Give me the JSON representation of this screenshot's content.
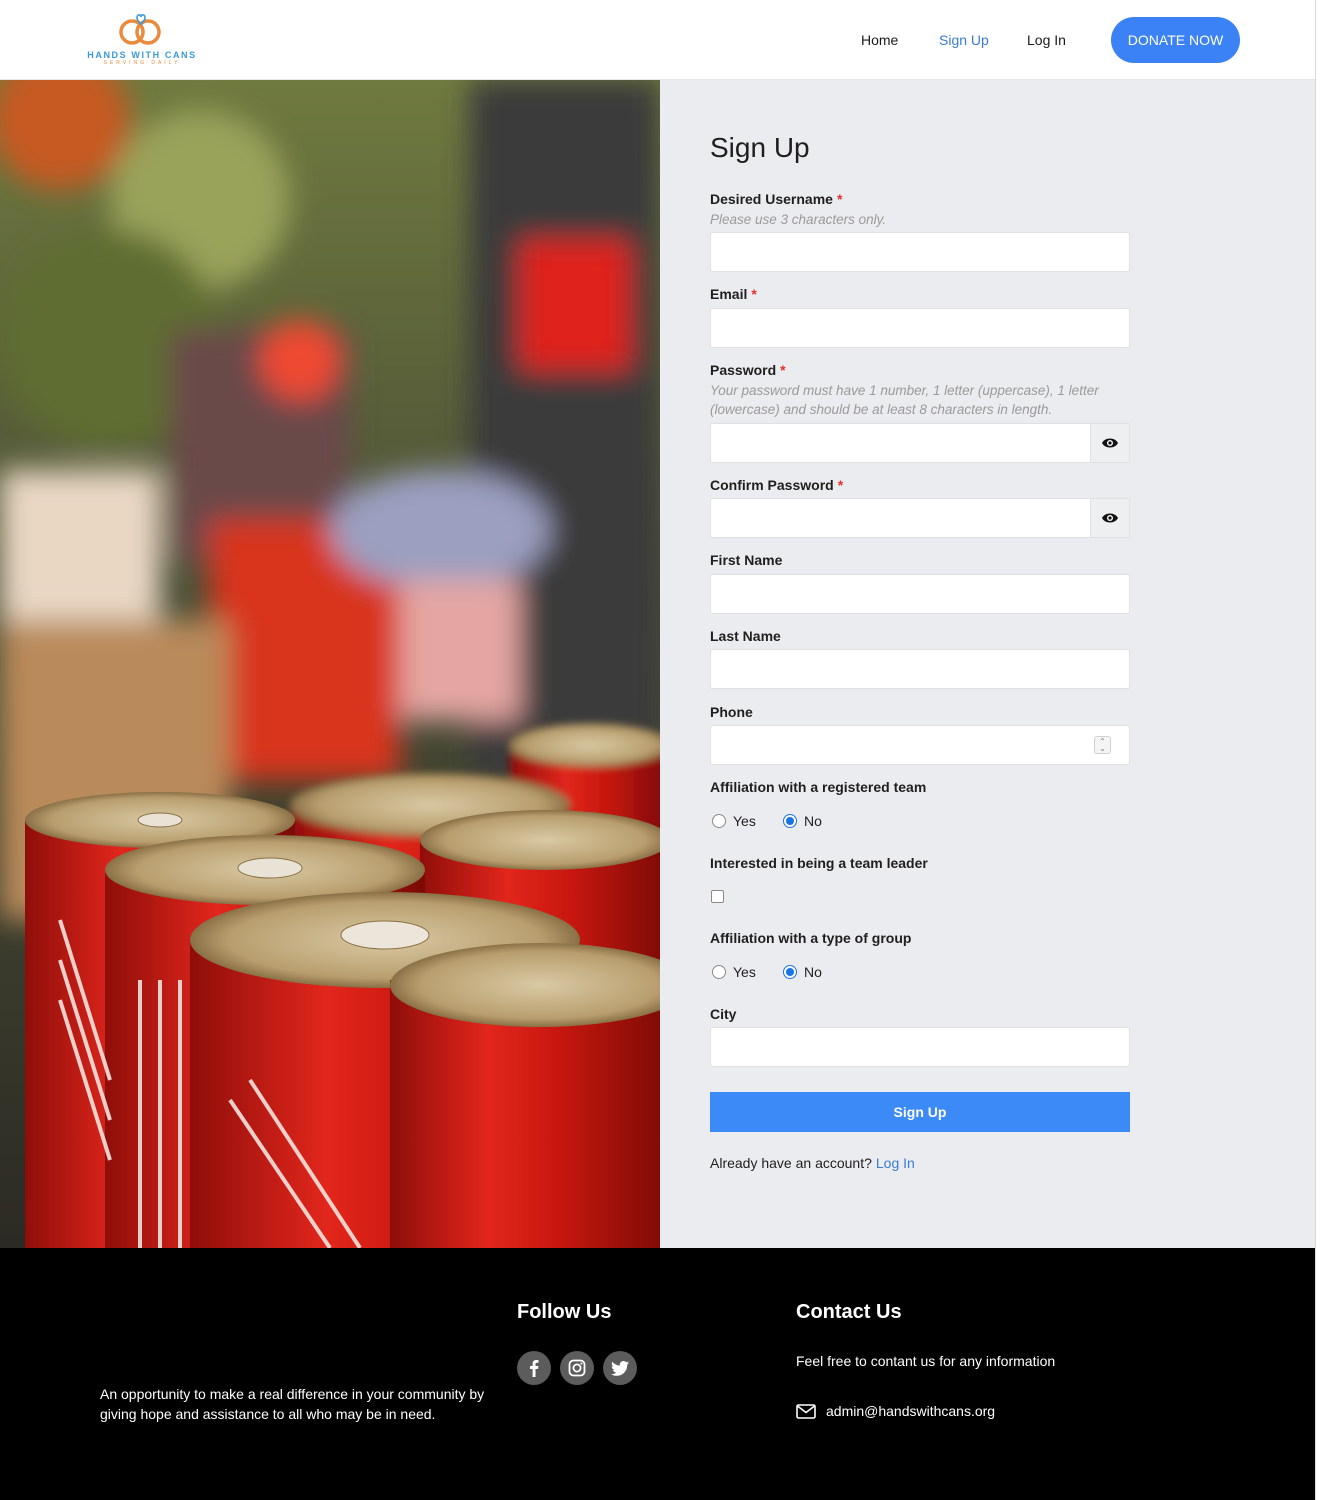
{
  "brand": {
    "name": "HANDS WITH CANS",
    "tagline": "SERVING DAILY"
  },
  "nav": {
    "home": "Home",
    "signup": "Sign Up",
    "login": "Log In",
    "donate": "DONATE NOW"
  },
  "colors": {
    "accent": "#3b82f6",
    "link": "#3a7bd5",
    "required": "#e03131",
    "panel_bg": "#ebecef",
    "footer_bg": "#000000"
  },
  "form": {
    "title": "Sign Up",
    "required_mark": "*",
    "username": {
      "label": "Desired Username",
      "hint": "Please use 3 characters only.",
      "value": "",
      "required": true
    },
    "email": {
      "label": "Email",
      "value": "",
      "required": true
    },
    "password": {
      "label": "Password",
      "hint": "Your password must have 1 number, 1 letter (uppercase), 1 letter (lowercase) and should be at least 8 characters in length.",
      "value": "",
      "required": true,
      "toggle_icon": "eye-icon"
    },
    "confirm_password": {
      "label": "Confirm Password",
      "value": "",
      "required": true,
      "toggle_icon": "eye-icon"
    },
    "first_name": {
      "label": "First Name",
      "value": ""
    },
    "last_name": {
      "label": "Last Name",
      "value": ""
    },
    "phone": {
      "label": "Phone",
      "value": "",
      "stepper_icon": "spinner-icon"
    },
    "affiliation_team": {
      "label": "Affiliation with a registered team",
      "options": [
        "Yes",
        "No"
      ],
      "selected": "No"
    },
    "team_leader": {
      "label": "Interested in being a team leader",
      "checked": false
    },
    "affiliation_group": {
      "label": "Affiliation with a type of group",
      "options": [
        "Yes",
        "No"
      ],
      "selected": "No"
    },
    "city": {
      "label": "City",
      "value": ""
    },
    "submit": "Sign Up",
    "already": "Already have an account?",
    "login_link": "Log In"
  },
  "footer": {
    "tagline": "An opportunity to make a real difference in your community by giving hope and assistance to all who may be in need.",
    "follow_title": "Follow Us",
    "social_icons": [
      "facebook-icon",
      "instagram-icon",
      "twitter-icon"
    ],
    "contact_title": "Contact Us",
    "contact_text": "Feel free to contant us for any information",
    "email": "admin@handswithcans.org",
    "email_icon": "envelope-icon"
  }
}
